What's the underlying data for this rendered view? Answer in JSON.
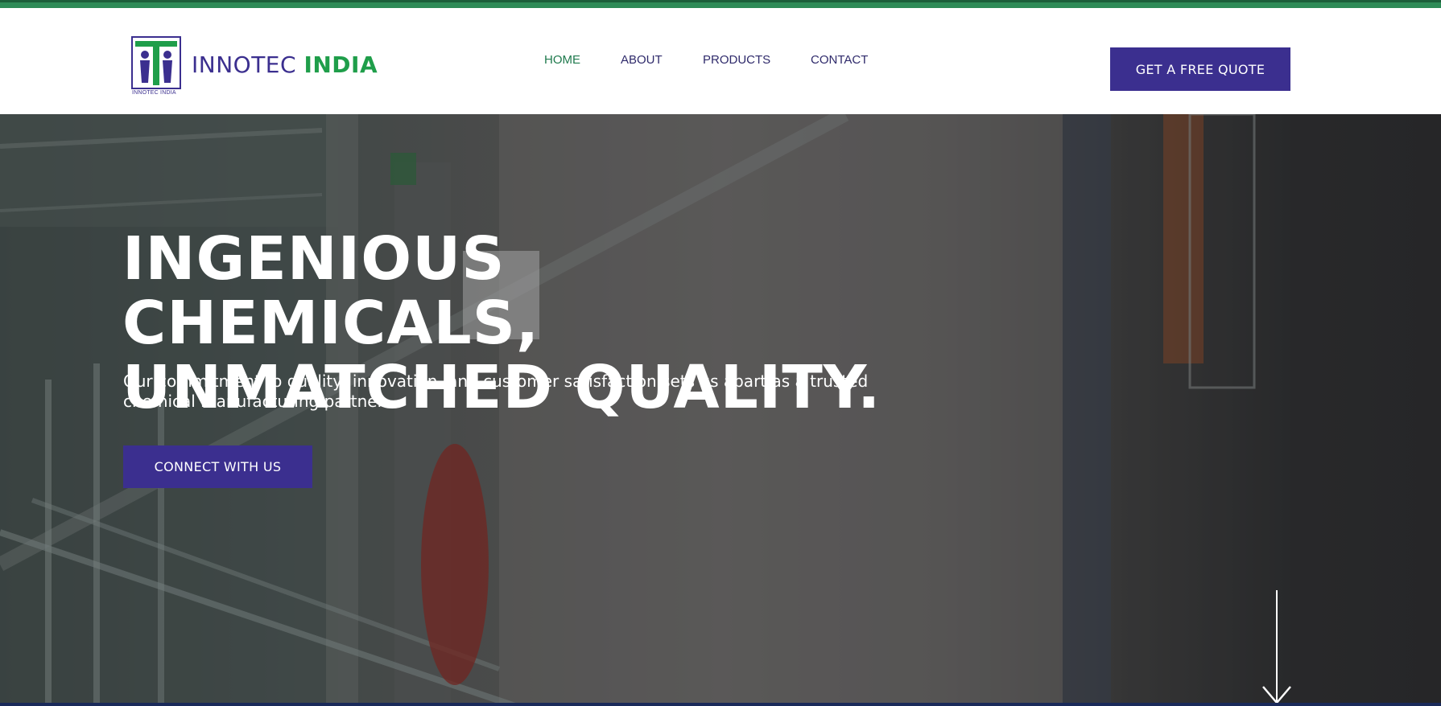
{
  "brand": {
    "name_part1": "INNOTEC",
    "name_part2": "INDIA",
    "logo_subtext": "INNOTEC INDIA",
    "colors": {
      "primary": "#3b2f8f",
      "green": "#1f9e4a",
      "accent_bar": "#2e8b57"
    }
  },
  "nav": {
    "items": [
      {
        "label": "HOME",
        "active": true
      },
      {
        "label": "ABOUT",
        "active": false
      },
      {
        "label": "PRODUCTS",
        "active": false
      },
      {
        "label": "CONTACT",
        "active": false
      }
    ]
  },
  "header": {
    "cta_label": "GET A FREE QUOTE"
  },
  "hero": {
    "title_line1": "INGENIOUS CHEMICALS,",
    "title_line2": "UNMATCHED QUALITY.",
    "description": "Our commitment to quality, innovation, and customer satisfaction sets us apart as a trusted chemical manufacturing partner.",
    "cta_label": "CONNECT WITH US",
    "scroll_icon": "arrow-down-icon"
  }
}
